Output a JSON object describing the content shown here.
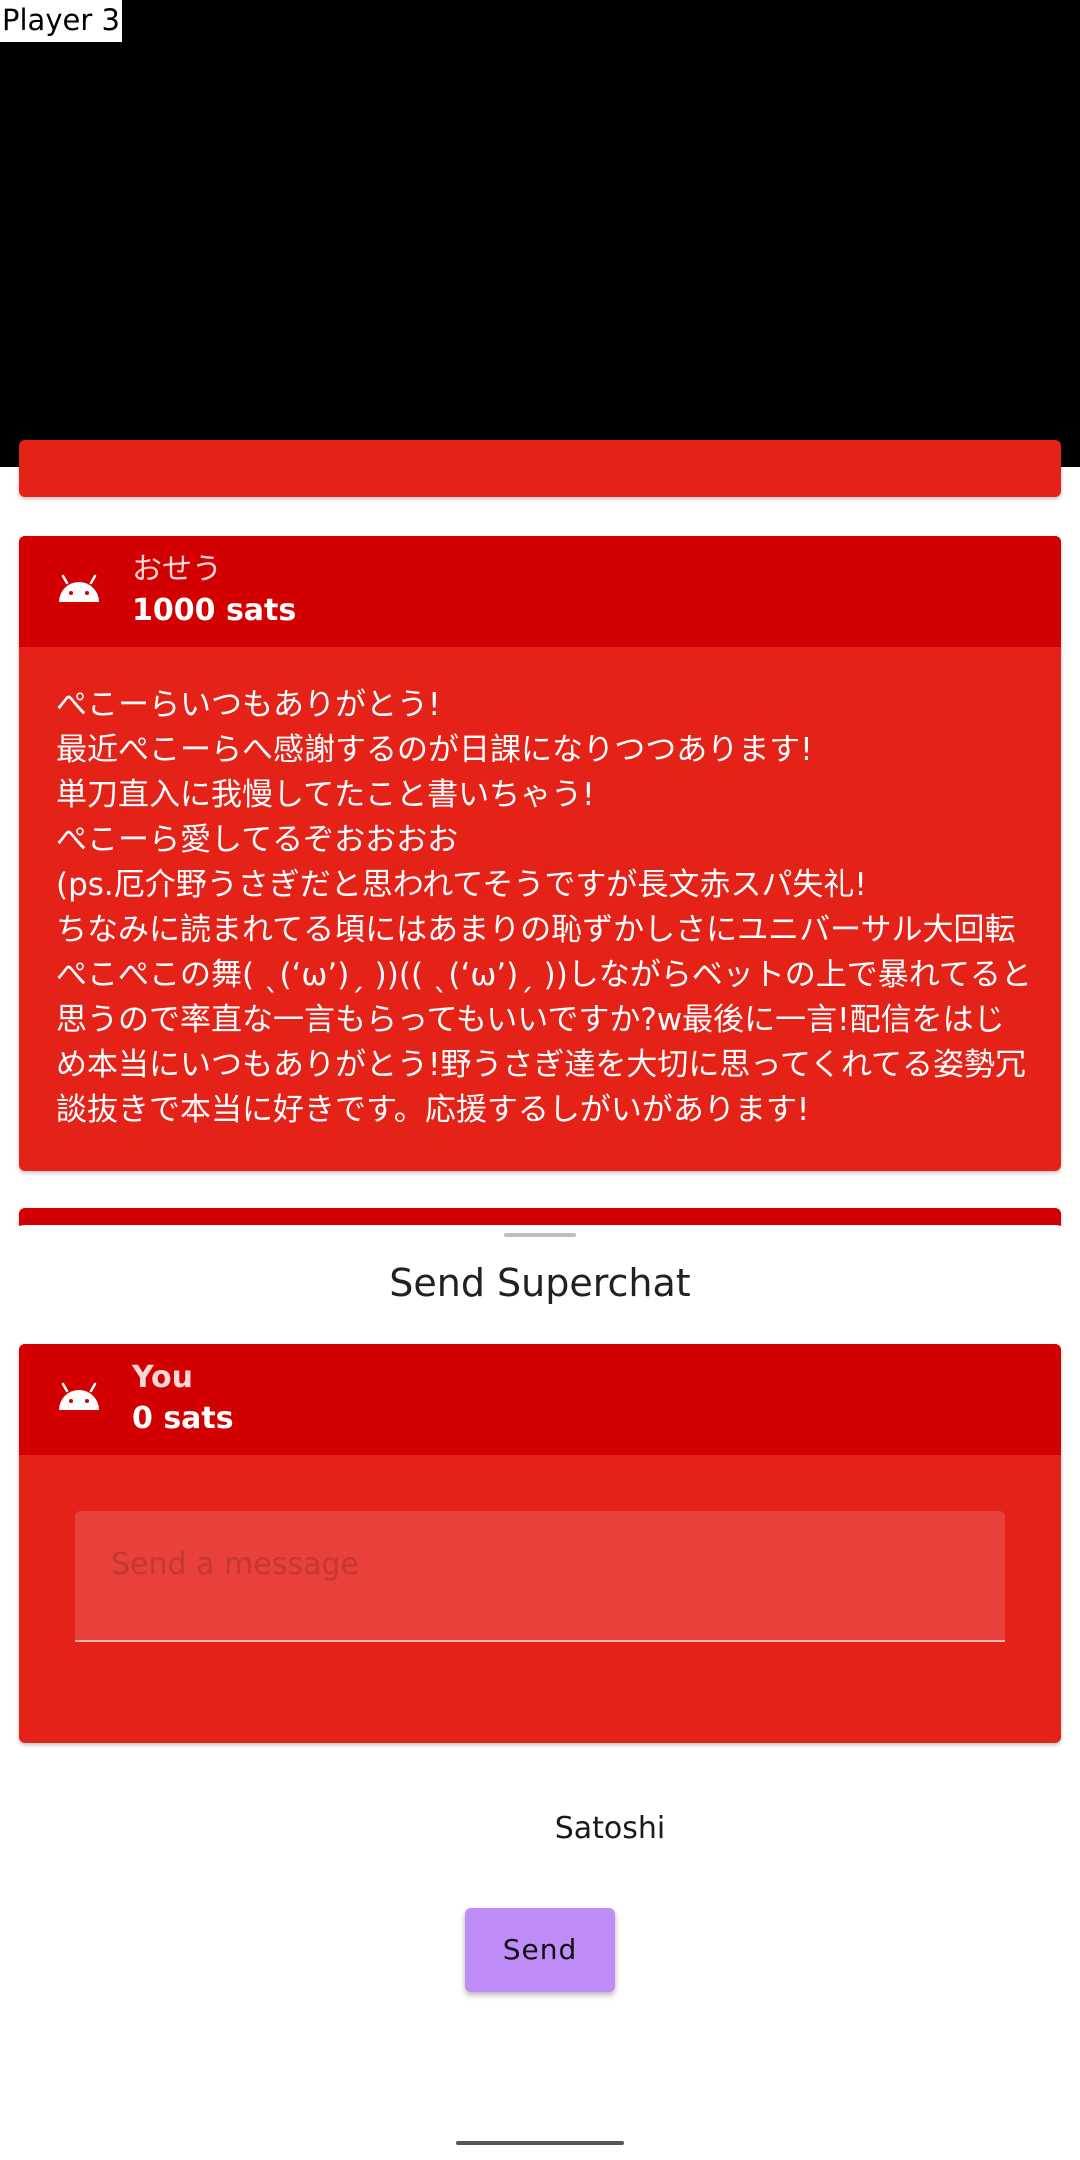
{
  "player": {
    "label": "Player 3"
  },
  "chat": {
    "cards": [
      {
        "sender": "おせう",
        "amount": "1000 sats",
        "message_lines": [
          "ぺこーらいつもありがとう!",
          "最近ぺこーらへ感謝するのが日課になりつつあります!",
          "単刀直入に我慢してたこと書いちゃう!",
          "ぺこーら愛してるぞおおおお",
          "(ps.厄介野うさぎだと思われてそうですが長文赤スパ失礼!",
          "ちなみに読まれてる頃にはあまりの恥ずかしさにユニバーサル大回転",
          "ぺこぺこの舞( ˎ(‘ω’)ˏ ))(( ˎ(‘ω’)ˏ ))しながらベットの上で暴れてると",
          "思うので率直な一言もらってもいいですか?w最後に一言!配信をはじ",
          "め本当にいつもありがとう!野うさぎ達を大切に思ってくれてる姿勢冗",
          "談抜きで本当に好きです。応援するしがいがあります!"
        ]
      }
    ]
  },
  "sheet": {
    "title": "Send Superchat",
    "preview": {
      "sender": "You",
      "amount": "0 sats"
    },
    "message_placeholder": "Send a message",
    "unit_label": "Satoshi",
    "send_label": "Send"
  },
  "colors": {
    "card_header": "#d20000",
    "card_body": "#e52218",
    "send_button": "#bf8cf8"
  }
}
